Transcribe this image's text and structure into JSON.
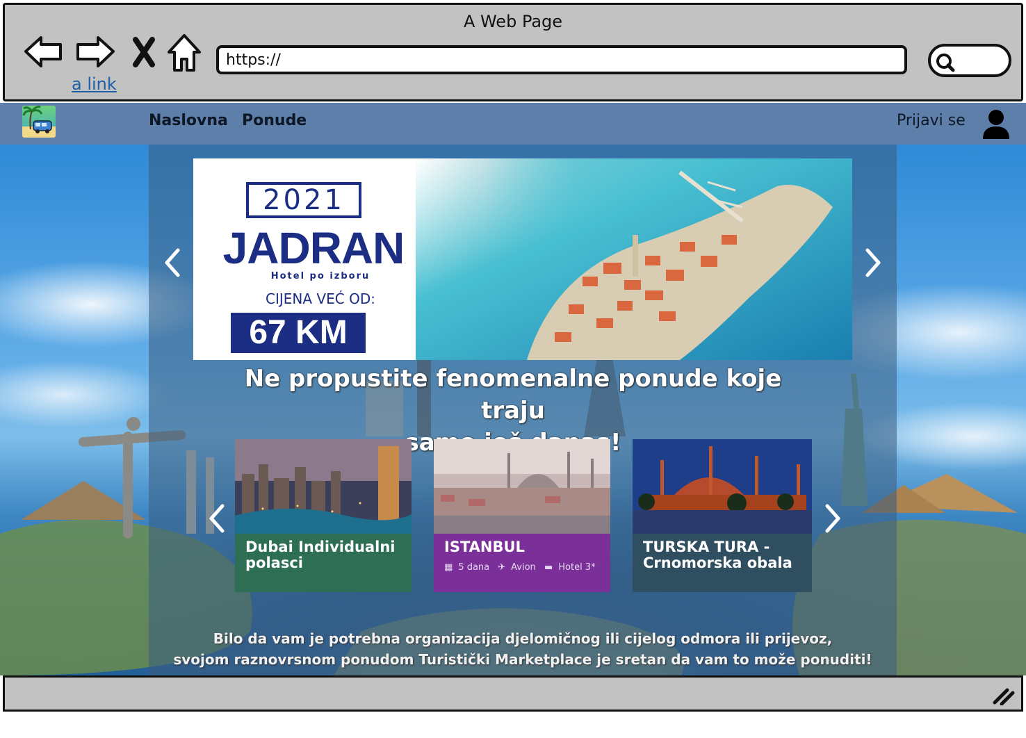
{
  "browser": {
    "window_title": "A Web Page",
    "link_text": "a link",
    "address": "https://"
  },
  "nav": {
    "items": [
      {
        "label": "Naslovna"
      },
      {
        "label": "Ponude"
      }
    ],
    "login_label": "Prijavi se"
  },
  "banner": {
    "year": "2021",
    "title": "JADRAN",
    "subtitle": "Hotel po izboru",
    "price_label": "CIJENA VEĆ OD:",
    "price": "67 KM"
  },
  "headline": {
    "line1": "Ne propustite fenomenalne ponude koje traju",
    "line2": "samo još danas!"
  },
  "offers": [
    {
      "title": "Dubai Individualni polasci",
      "color": "#2d6e55"
    },
    {
      "title": "ISTANBUL",
      "color": "#7b2f98",
      "meta": {
        "duration": "5 dana",
        "transport": "Avion",
        "accommodation": "Hotel 3*"
      }
    },
    {
      "title": "TURSKA TURA - Crnomorska obala",
      "color": "#2f4e5f"
    }
  ],
  "footer": {
    "line1": "Bilo da vam je potrebna organizacija djelomičnog ili cijelog odmora ili prijevoz,",
    "line2": "svojom raznovrsnom ponudom Turistički Marketplace je sretan da vam to može ponuditi!"
  }
}
